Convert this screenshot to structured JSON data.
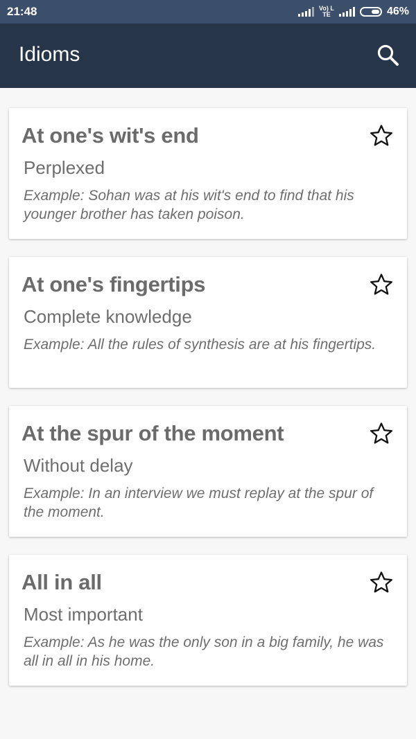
{
  "status_bar": {
    "time": "21:48",
    "network_label": "Vo) LTE",
    "battery_percent": "46%",
    "battery_level": 0.46
  },
  "app_bar": {
    "title": "Idioms",
    "search_icon": "search-icon"
  },
  "idioms": [
    {
      "phrase": "At one's wit's end",
      "meaning": "Perplexed",
      "example": "Example: Sohan was at his wit's end to find that his younger brother has taken poison.",
      "favorite": false
    },
    {
      "phrase": "At one's fingertips",
      "meaning": "Complete knowledge",
      "example": "Example: All the rules of synthesis are at his fingertips.",
      "favorite": false
    },
    {
      "phrase": "At the spur of the moment",
      "meaning": "Without delay",
      "example": "Example: In an interview we must replay at the spur of the moment.",
      "favorite": false
    },
    {
      "phrase": "All in all",
      "meaning": "Most important",
      "example": "Example: As he was the only son in a big family, he was all in all in his home.",
      "favorite": false
    }
  ],
  "colors": {
    "status_bar": "#3c4f6a",
    "app_bar": "#263548",
    "background": "#f7f7f7",
    "card": "#ffffff",
    "text": "#6b6b6b"
  }
}
